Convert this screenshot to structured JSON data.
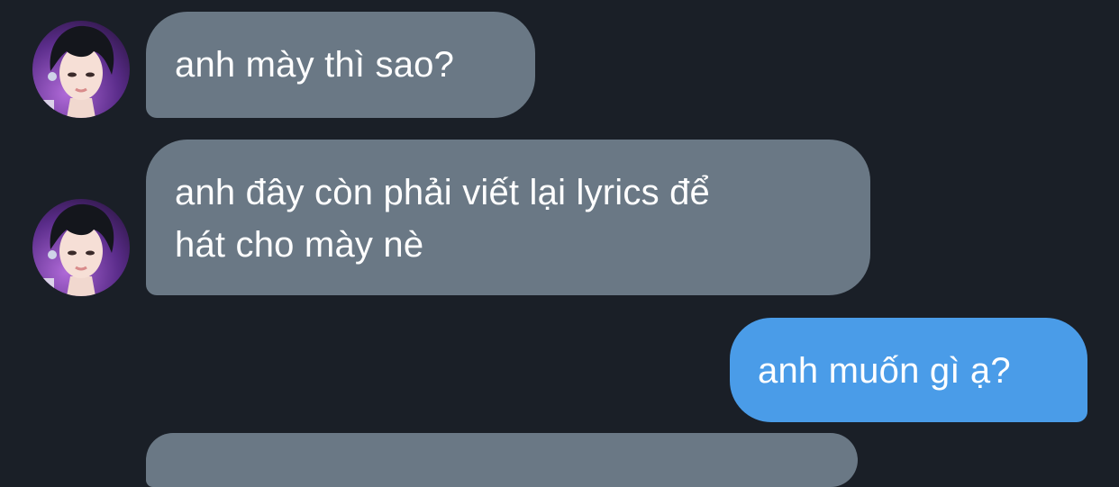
{
  "colors": {
    "background": "#1a1f27",
    "incoming_bubble": "#6a7885",
    "outgoing_bubble": "#4a9ce8",
    "text": "#ffffff"
  },
  "messages": [
    {
      "sender": "other",
      "lines": [
        "anh mày thì sao?"
      ]
    },
    {
      "sender": "other",
      "lines": [
        "anh đây còn phải viết lại lyrics để",
        "hát cho mày nè"
      ]
    },
    {
      "sender": "me",
      "lines": [
        "anh muốn gì ạ?"
      ]
    }
  ]
}
